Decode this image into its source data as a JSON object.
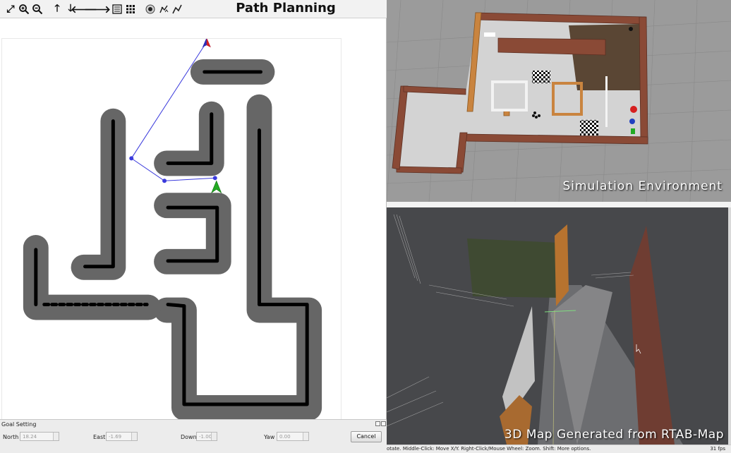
{
  "toolbar": {
    "title": "Path Planning",
    "icons": [
      "fit-view-icon",
      "zoom-in-icon",
      "zoom-out-icon",
      "pan-up-icon",
      "pan-down-icon",
      "pan-left-icon",
      "pan-right-icon",
      "list-icon",
      "grid-icon",
      "goal-point-icon",
      "robot-icon",
      "path-icon"
    ]
  },
  "goal_setting": {
    "title": "Goal Setting",
    "north": {
      "label": "North",
      "value": "18.24"
    },
    "east": {
      "label": "East",
      "value": "-1.69"
    },
    "down": {
      "label": "Down",
      "value": "-1.00"
    },
    "yaw": {
      "label": "Yaw",
      "value": "0.00"
    },
    "cancel_label": "Cancel"
  },
  "simulation": {
    "caption": "Simulation Environment"
  },
  "map3d": {
    "caption": "3D Map Generated from RTAB-Map",
    "status_text": "otate. Middle-Click: Move X/Y. Right-Click/Mouse Wheel: Zoom. Shift: More options.",
    "fps": "31 fps"
  },
  "colors": {
    "obstacle_inflation": "#666666",
    "obstacle": "#000000",
    "path": "#3a3adc",
    "goal_marker": "#d62020",
    "robot_marker": "#22aa22",
    "wall_brick": "#8a4a36",
    "wall_wood": "#c9843f",
    "map_background": "#47484b"
  }
}
